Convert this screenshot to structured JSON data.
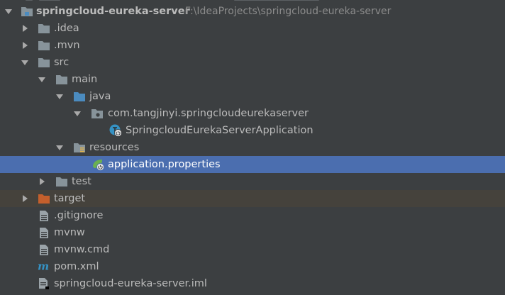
{
  "project": {
    "name": "springcloud-eureka-server",
    "path": "F:\\IdeaProjects\\springcloud-eureka-server"
  },
  "tree": {
    "idea": ".idea",
    "mvn": ".mvn",
    "src": "src",
    "main": "main",
    "java": "java",
    "package": "com.tangjinyi.springcloudeurekaserver",
    "app_class": "SpringcloudEurekaServerApplication",
    "resources": "resources",
    "app_properties": "application.properties",
    "test": "test",
    "target": "target",
    "gitignore": ".gitignore",
    "mvnw": "mvnw",
    "mvnw_cmd": "mvnw.cmd",
    "pom": "pom.xml",
    "iml": "springcloud-eureka-server.iml"
  },
  "colors": {
    "background": "#3c3f41",
    "selection": "#4b6eaf",
    "folder": "#87939a",
    "source_folder": "#4b8bbf",
    "excluded_folder": "#c45f2c",
    "spring_green": "#6bb04f"
  }
}
